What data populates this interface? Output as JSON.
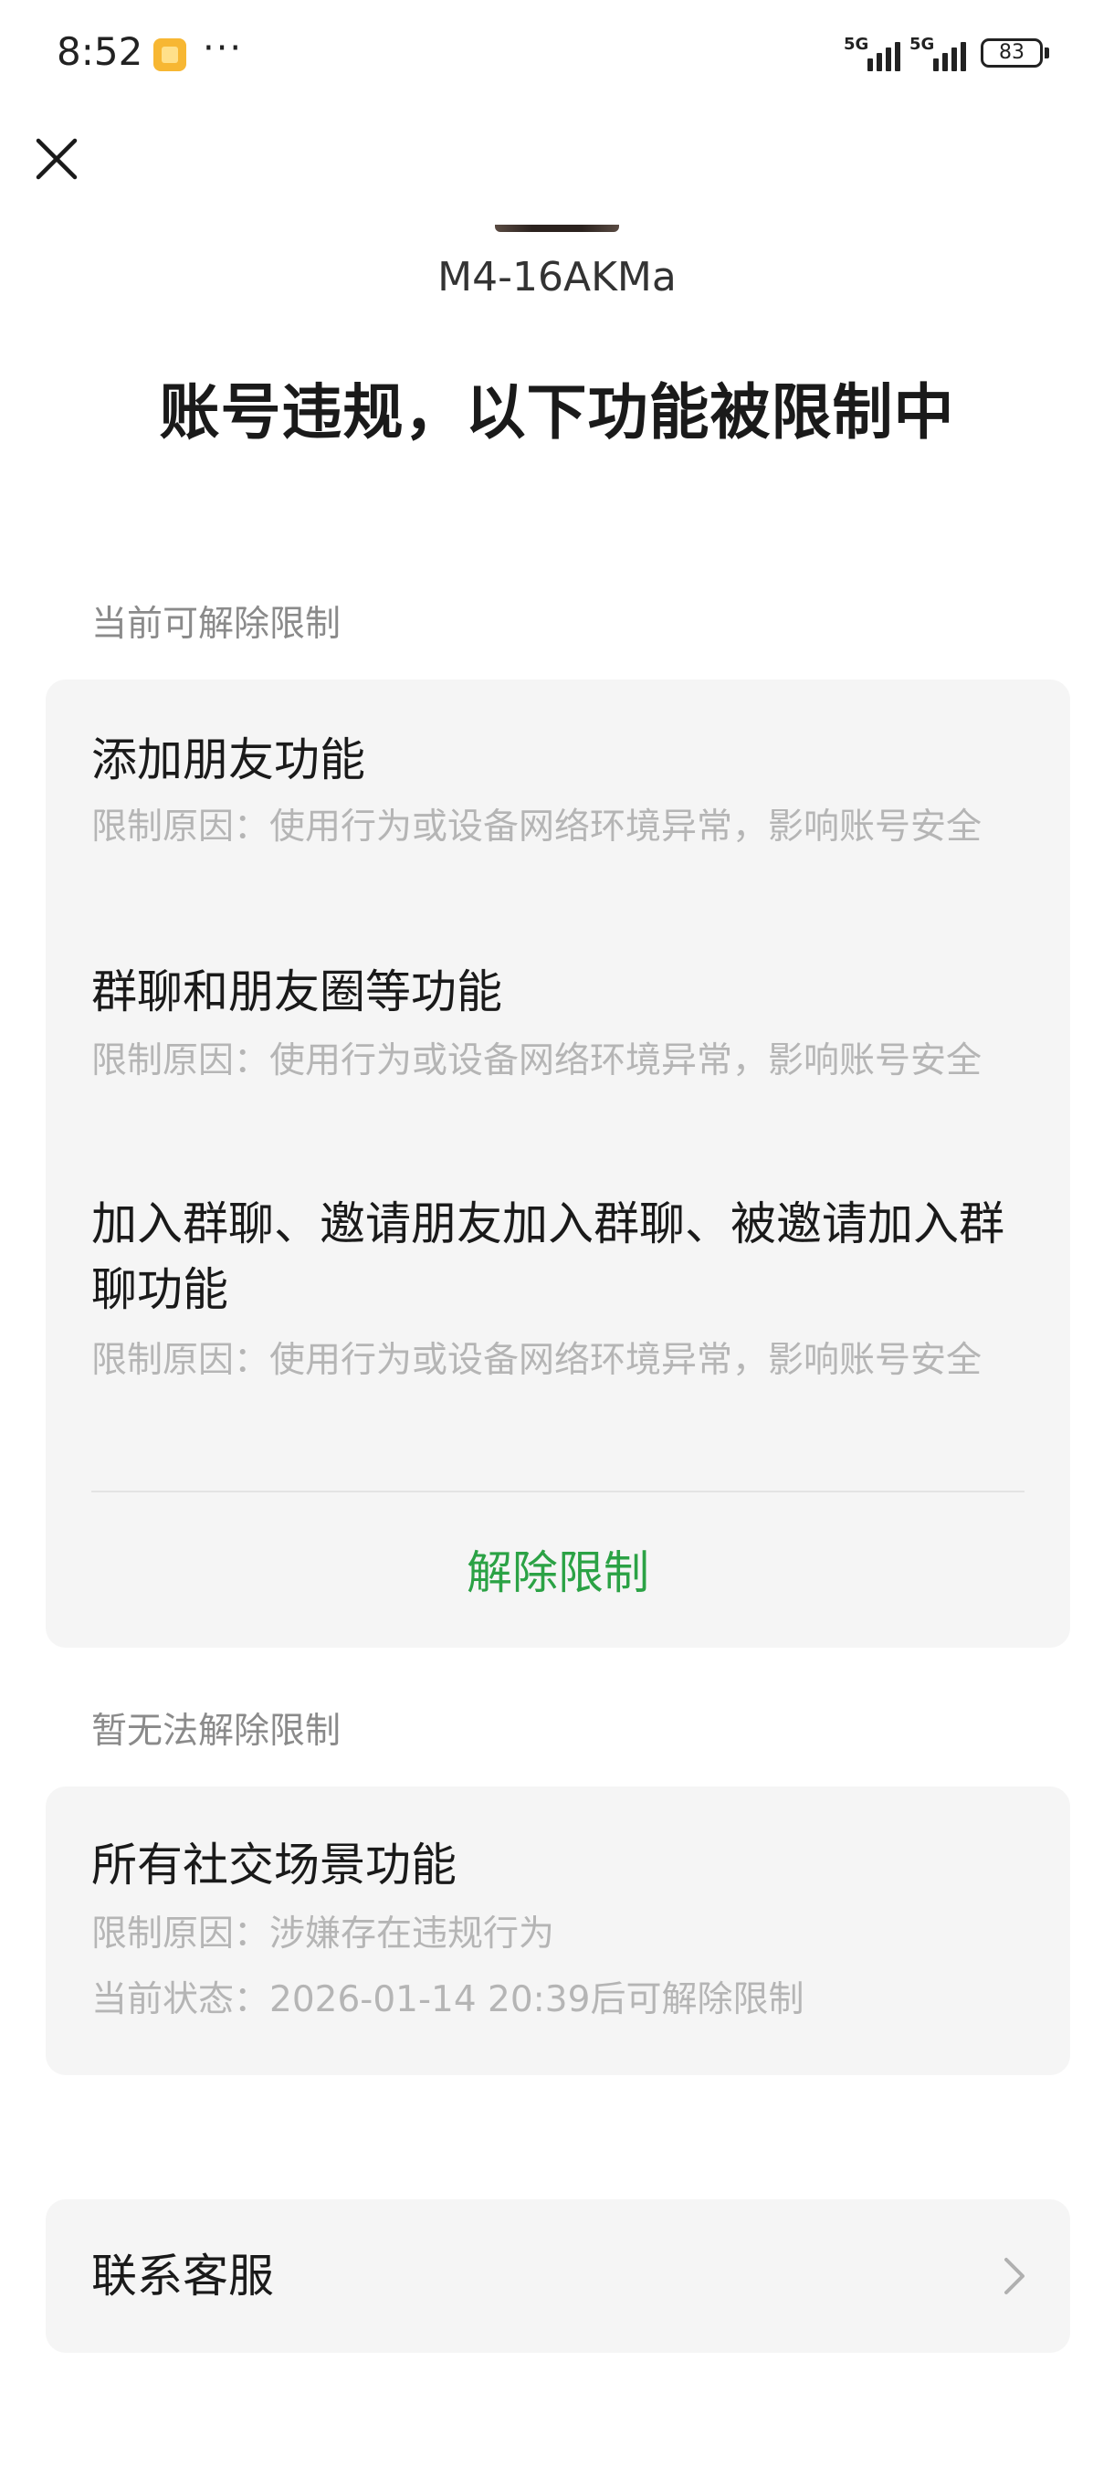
{
  "status_bar": {
    "time": "8:52",
    "notification_icon": "app-notification-icon",
    "more": "···",
    "signal_1_label": "5G",
    "signal_2_label": "5G",
    "battery": "83"
  },
  "header": {
    "close_icon": "close-icon"
  },
  "device": {
    "name": "M4-16AKMa"
  },
  "title": "账号违规，以下功能被限制中",
  "removable": {
    "section_label": "当前可解除限制",
    "items": [
      {
        "title": "添加朋友功能",
        "reason": "限制原因：使用行为或设备网络环境异常，影响账号安全"
      },
      {
        "title": "群聊和朋友圈等功能",
        "reason": "限制原因：使用行为或设备网络环境异常，影响账号安全"
      },
      {
        "title": "加入群聊、邀请朋友加入群聊、被邀请加入群聊功能",
        "reason": "限制原因：使用行为或设备网络环境异常，影响账号安全"
      }
    ],
    "action_label": "解除限制"
  },
  "non_removable": {
    "section_label": "暂无法解除限制",
    "item": {
      "title": "所有社交场景功能",
      "reason": "限制原因：涉嫌存在违规行为",
      "status": "当前状态：2026-01-14 20:39后可解除限制"
    }
  },
  "support": {
    "label": "联系客服",
    "icon": "chevron-right-icon"
  },
  "colors": {
    "accent": "#2ba245",
    "card_bg": "#f5f5f5",
    "muted_text": "#b5b5b5",
    "section_text": "#8a8a8a"
  }
}
